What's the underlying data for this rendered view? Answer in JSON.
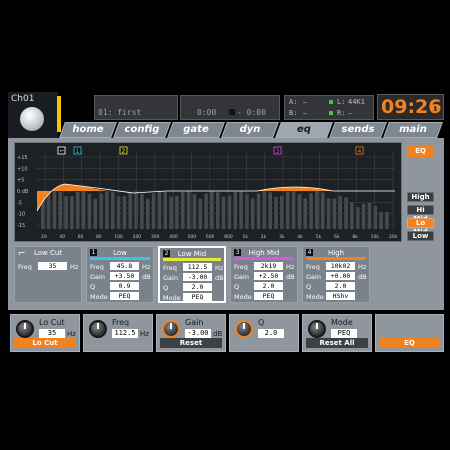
{
  "channel": {
    "name": "Ch01"
  },
  "scene": {
    "label": "01: first"
  },
  "transport": {
    "time_a": "0:00",
    "time_b": "- 0:00"
  },
  "io": {
    "a_label": "A:",
    "a_val": "–",
    "b_label": "B:",
    "b_val": "–",
    "l_label": "L:",
    "l_val": "44K1",
    "r_label": "R:",
    "r_val": "–"
  },
  "clock": {
    "time": "09:26",
    "seconds": "10"
  },
  "tabs": [
    {
      "label": "home"
    },
    {
      "label": "config"
    },
    {
      "label": "gate"
    },
    {
      "label": "dyn"
    },
    {
      "label": "eq"
    },
    {
      "label": "sends"
    },
    {
      "label": "main"
    }
  ],
  "active_tab": "eq",
  "graph": {
    "y_ticks": [
      "+15",
      "+10",
      "+5",
      "0 dB",
      "-5",
      "-10",
      "-15"
    ],
    "x_ticks": [
      "20",
      "40",
      "60",
      "80",
      "100",
      "200",
      "300",
      "400",
      "500",
      "600",
      "800",
      "1k",
      "2k",
      "3k",
      "4k",
      "5k",
      "6k",
      "8k",
      "10k",
      "20k"
    ],
    "markers": [
      "⌐",
      "1",
      "2",
      "3",
      "4"
    ]
  },
  "side": {
    "eq_label": "EQ",
    "bands": [
      "High",
      "Hi Mid",
      "Lo Mid",
      "Low"
    ],
    "selected_band": "Lo Mid"
  },
  "cards": [
    {
      "id": "lowcut",
      "title": "Low Cut",
      "num": "",
      "bar": "",
      "rows": [
        {
          "k": "Freq",
          "v": "35",
          "u": "Hz"
        }
      ]
    },
    {
      "id": "low",
      "title": "Low",
      "num": "1",
      "bar": "#35c8e0",
      "rows": [
        {
          "k": "Freq",
          "v": "45.8",
          "u": "Hz"
        },
        {
          "k": "Gain",
          "v": "+3.50",
          "u": "dB"
        },
        {
          "k": "Q",
          "v": "0.9",
          "u": ""
        },
        {
          "k": "Mode",
          "v": "PEQ",
          "u": ""
        }
      ]
    },
    {
      "id": "lowmid",
      "title": "Low Mid",
      "num": "2",
      "bar": "#e6e93a",
      "rows": [
        {
          "k": "Freq",
          "v": "112.5",
          "u": "Hz"
        },
        {
          "k": "Gain",
          "v": "-3.00",
          "u": "dB"
        },
        {
          "k": "Q",
          "v": "2.0",
          "u": ""
        },
        {
          "k": "Mode",
          "v": "PEQ",
          "u": ""
        }
      ]
    },
    {
      "id": "highmid",
      "title": "High Mid",
      "num": "3",
      "bar": "#d659e6",
      "rows": [
        {
          "k": "Freq",
          "v": "2k19",
          "u": "Hz"
        },
        {
          "k": "Gain",
          "v": "+2.50",
          "u": "dB"
        },
        {
          "k": "Q",
          "v": "2.0",
          "u": ""
        },
        {
          "k": "Mode",
          "v": "PEQ",
          "u": ""
        }
      ]
    },
    {
      "id": "high",
      "title": "High",
      "num": "4",
      "bar": "#f0821f",
      "rows": [
        {
          "k": "Freq",
          "v": "10k02",
          "u": "Hz"
        },
        {
          "k": "Gain",
          "v": "+0.00",
          "u": "dB"
        },
        {
          "k": "Q",
          "v": "2.0",
          "u": ""
        },
        {
          "k": "Mode",
          "v": "HShv",
          "u": ""
        }
      ]
    }
  ],
  "encoders": [
    {
      "label": "Lo Cut",
      "value": "35",
      "unit": "Hz",
      "button": "Lo Cut",
      "button_orange": true
    },
    {
      "label": "Freq",
      "value": "112.5",
      "unit": "Hz",
      "button": "",
      "button_orange": false
    },
    {
      "label": "Gain",
      "value": "-3.00",
      "unit": "dB",
      "button": "Reset",
      "button_orange": false
    },
    {
      "label": "Q",
      "value": "2.0",
      "unit": "",
      "button": "",
      "button_orange": false
    },
    {
      "label": "Mode",
      "value": "PEQ",
      "unit": "",
      "button": "Reset All",
      "button_orange": false
    },
    {
      "label": "",
      "value": "",
      "unit": "",
      "button": "EQ",
      "button_orange": true
    }
  ]
}
